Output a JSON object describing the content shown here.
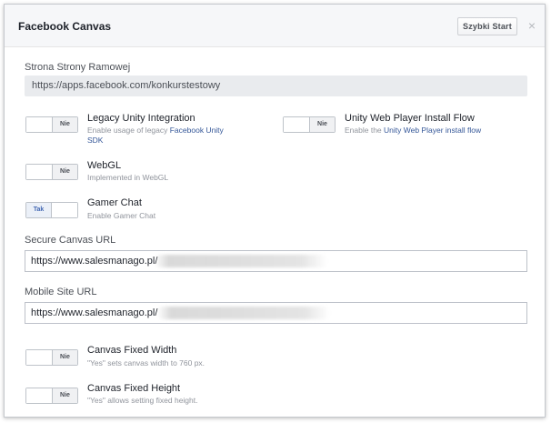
{
  "dialog": {
    "title": "Facebook Canvas",
    "quick_start_label": "Szybki Start",
    "close_glyph": "×"
  },
  "frame_page": {
    "label": "Strona Strony Ramowej",
    "value": "https://apps.facebook.com/konkurstestowy"
  },
  "toggle_labels": {
    "yes": "Tak",
    "no": "Nie"
  },
  "legacy_unity": {
    "title": "Legacy Unity Integration",
    "desc_prefix": "Enable usage of legacy ",
    "desc_link": "Facebook Unity",
    "desc_line2": "SDK",
    "state": "no"
  },
  "unity_web_player": {
    "title": "Unity Web Player Install Flow",
    "desc_prefix": "Enable the ",
    "desc_link": "Unity Web Player install flow",
    "state": "no"
  },
  "webgl": {
    "title": "WebGL",
    "desc": "Implemented in WebGL",
    "state": "no"
  },
  "gamer_chat": {
    "title": "Gamer Chat",
    "desc": "Enable Gamer Chat",
    "state": "yes"
  },
  "secure_canvas": {
    "label": "Secure Canvas URL",
    "value": "https://www.salesmanago.pl/"
  },
  "mobile_site": {
    "label": "Mobile Site URL",
    "value": "https://www.salesmanago.pl/"
  },
  "fixed_width": {
    "title": "Canvas Fixed Width",
    "desc": "\"Yes\" sets canvas width to 760 px.",
    "state": "no"
  },
  "fixed_height": {
    "title": "Canvas Fixed Height",
    "desc": "\"Yes\" allows setting fixed height.",
    "state": "no"
  }
}
